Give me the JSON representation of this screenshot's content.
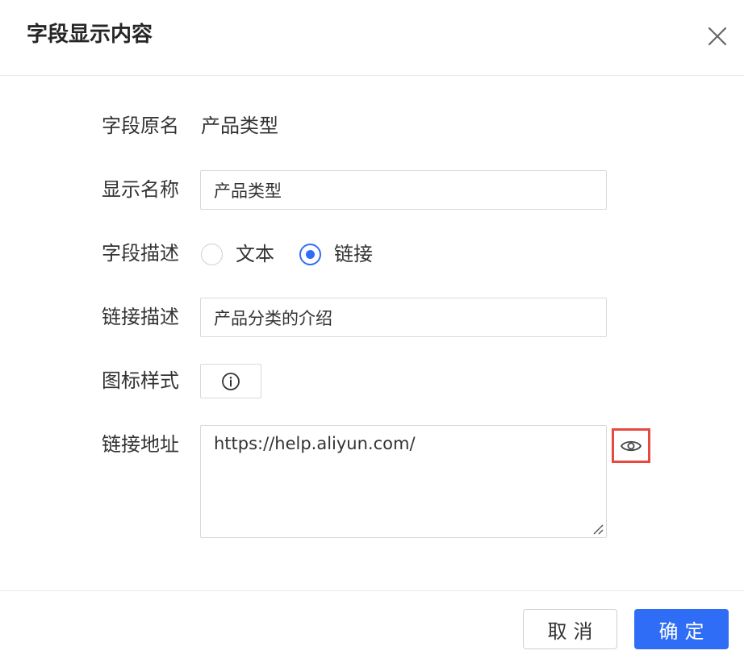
{
  "dialog": {
    "title": "字段显示内容",
    "close_icon": "close-icon"
  },
  "form": {
    "original_name": {
      "label": "字段原名",
      "value": "产品类型"
    },
    "display_name": {
      "label": "显示名称",
      "value": "产品类型"
    },
    "description_type": {
      "label": "字段描述",
      "options": [
        {
          "label": "文本",
          "checked": false
        },
        {
          "label": "链接",
          "checked": true
        }
      ]
    },
    "link_description": {
      "label": "链接描述",
      "value": "产品分类的介绍"
    },
    "icon_style": {
      "label": "图标样式",
      "icon": "info-circle-icon"
    },
    "link_url": {
      "label": "链接地址",
      "value": "https://help.aliyun.com/",
      "preview_icon": "eye-icon"
    }
  },
  "footer": {
    "cancel_label": "取消",
    "confirm_label": "确定"
  },
  "colors": {
    "primary": "#2f6df6",
    "highlight": "#e8493e",
    "border": "#d9d9d9",
    "text": "#333333"
  }
}
